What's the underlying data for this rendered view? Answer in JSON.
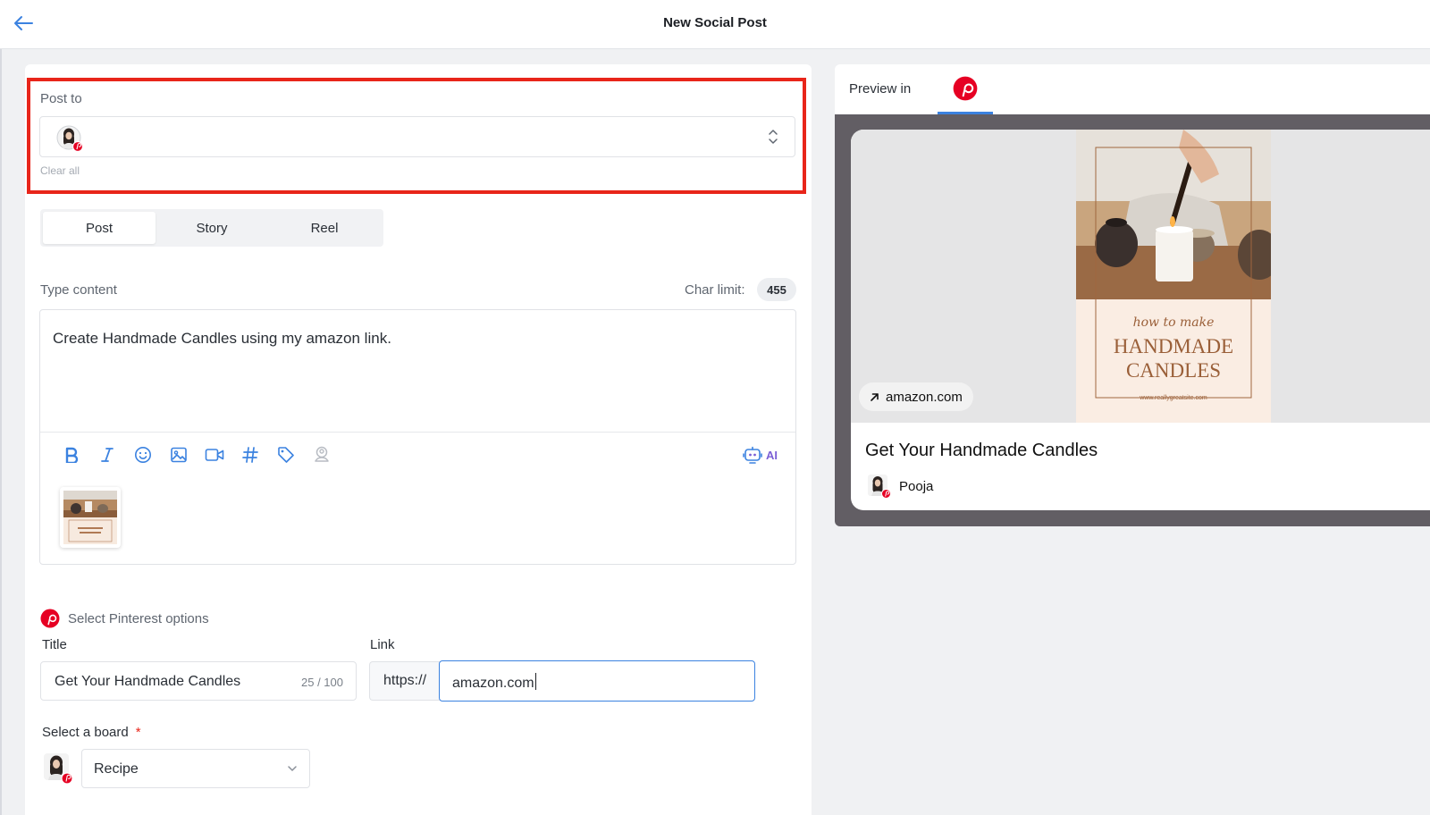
{
  "header": {
    "title": "New Social Post"
  },
  "post_to": {
    "label": "Post to",
    "clear_label": "Clear all"
  },
  "tabs": [
    {
      "label": "Post",
      "active": true
    },
    {
      "label": "Story",
      "active": false
    },
    {
      "label": "Reel",
      "active": false
    }
  ],
  "content": {
    "label": "Type content",
    "char_limit_label": "Char limit:",
    "char_count": "455",
    "text": "Create Handmade Candles using my amazon link.",
    "ai_label": "AI"
  },
  "toolbar_icons": [
    "bold-icon",
    "italic-icon",
    "emoji-icon",
    "image-icon",
    "video-icon",
    "hashtag-icon",
    "tag-icon",
    "location-icon"
  ],
  "pinterest": {
    "options_label": "Select Pinterest options",
    "title_label": "Title",
    "title_value": "Get Your Handmade Candles",
    "title_count": "25 / 100",
    "link_label": "Link",
    "link_prefix": "https://",
    "link_value": "amazon.com",
    "board_label": "Select a board",
    "board_required": "*",
    "board_value": "Recipe"
  },
  "preview": {
    "label": "Preview in",
    "domain": "amazon.com",
    "pin_title": "Get Your Handmade Candles",
    "author": "Pooja",
    "image_text": {
      "script": "how to make",
      "line1": "HANDMADE",
      "line2": "CANDLES",
      "site": "www.reallygreatsite.com"
    }
  },
  "colors": {
    "accent": "#3b82e0",
    "pinterest": "#e60023",
    "highlight": "#e8251a",
    "ai": "#7b5fd6"
  }
}
